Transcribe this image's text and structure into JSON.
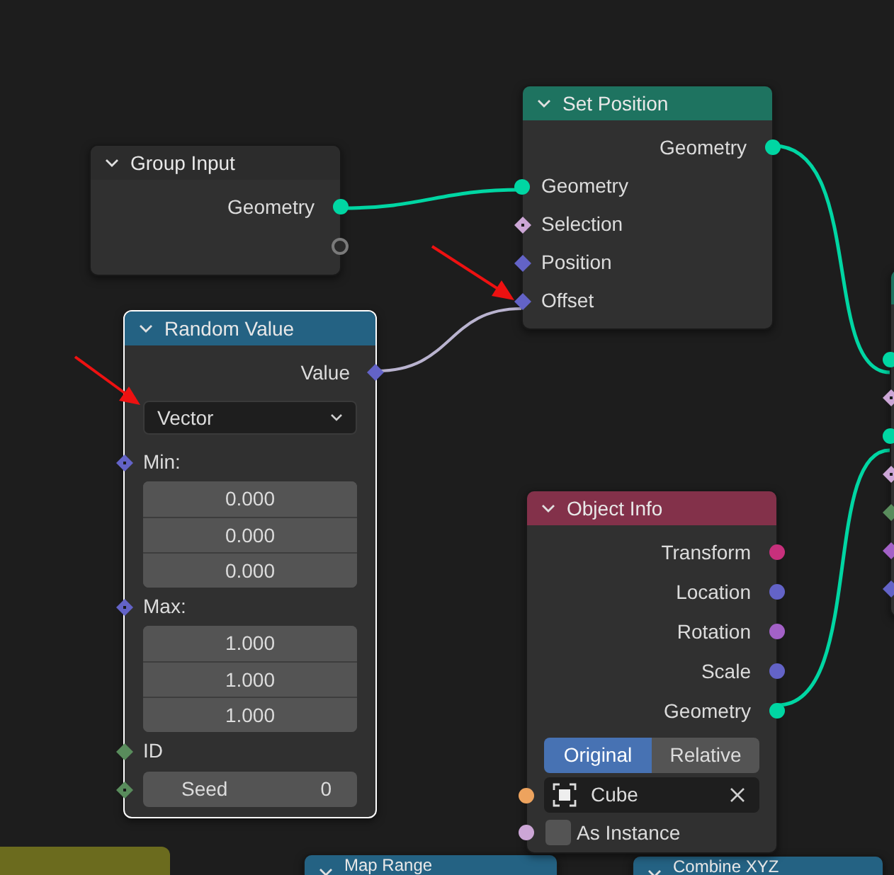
{
  "nodes": [
    {
      "title": "Group Input",
      "color": "#2c2c2c",
      "expanded": true,
      "selected": false,
      "rows": [
        {
          "kind": "output",
          "label": "Geometry",
          "socket": {
            "kind": "circle",
            "color": "#00d6a3"
          }
        },
        {
          "kind": "empty",
          "socket": {
            "kind": "hollow",
            "color": "#7a7a7a"
          }
        }
      ]
    },
    {
      "title": "Set Position",
      "color": "#1e7360",
      "expanded": true,
      "selected": false,
      "rows": [
        {
          "kind": "output",
          "label": "Geometry",
          "socket": {
            "kind": "circle",
            "color": "#00d6a3"
          }
        },
        {
          "kind": "input",
          "label": "Geometry",
          "socket": {
            "kind": "circle",
            "color": "#00d6a3"
          }
        },
        {
          "kind": "input",
          "label": "Selection",
          "socket": {
            "kind": "diamond-dot",
            "color": "#cca6d6"
          }
        },
        {
          "kind": "input",
          "label": "Position",
          "socket": {
            "kind": "diamond",
            "color": "#6363c7"
          }
        },
        {
          "kind": "input",
          "label": "Offset",
          "socket": {
            "kind": "diamond",
            "color": "#6363c7"
          }
        }
      ]
    },
    {
      "title": "Random Value",
      "color": "#246283",
      "expanded": true,
      "selected": true,
      "rows": [
        {
          "kind": "output",
          "label": "Value",
          "socket": {
            "kind": "diamond",
            "color": "#6363c7"
          }
        },
        {
          "kind": "dropdown",
          "value": "Vector"
        },
        {
          "kind": "input",
          "label": "Min:",
          "socket": {
            "kind": "diamond-dot",
            "color": "#6363c7"
          }
        },
        {
          "kind": "vector",
          "values": [
            "0.000",
            "0.000",
            "0.000"
          ]
        },
        {
          "kind": "input",
          "label": "Max:",
          "socket": {
            "kind": "diamond-dot",
            "color": "#6363c7"
          }
        },
        {
          "kind": "vector",
          "values": [
            "1.000",
            "1.000",
            "1.000"
          ]
        },
        {
          "kind": "input",
          "label": "ID",
          "socket": {
            "kind": "diamond",
            "color": "#598c5c"
          }
        },
        {
          "kind": "number",
          "label": "Seed",
          "value": "0",
          "socket": {
            "kind": "diamond-dot",
            "color": "#598c5c"
          }
        }
      ]
    },
    {
      "title": "Object Info",
      "color": "#83314a",
      "expanded": true,
      "selected": false,
      "rows": [
        {
          "kind": "output",
          "label": "Transform",
          "socket": {
            "kind": "circle",
            "color": "#c7307c"
          }
        },
        {
          "kind": "output",
          "label": "Location",
          "socket": {
            "kind": "circle",
            "color": "#6363c7"
          }
        },
        {
          "kind": "output",
          "label": "Rotation",
          "socket": {
            "kind": "circle",
            "color": "#a361c7"
          }
        },
        {
          "kind": "output",
          "label": "Scale",
          "socket": {
            "kind": "circle",
            "color": "#6363c7"
          }
        },
        {
          "kind": "output",
          "label": "Geometry",
          "socket": {
            "kind": "circle",
            "color": "#00d6a3"
          }
        },
        {
          "kind": "segmented",
          "options": [
            {
              "label": "Original",
              "selected": true
            },
            {
              "label": "Relative",
              "selected": false
            }
          ]
        },
        {
          "kind": "object",
          "value": "Cube",
          "socket": {
            "kind": "circle",
            "color": "#eda35e"
          }
        },
        {
          "kind": "checkbox",
          "label": "As Instance",
          "checked": false,
          "socket": {
            "kind": "circle",
            "color": "#cca6d6"
          }
        }
      ]
    },
    {
      "title": "Map Range",
      "color": "#246283",
      "expanded": true,
      "selected": false
    },
    {
      "title": "Combine XYZ",
      "color": "#246283",
      "expanded": true,
      "selected": false
    },
    {
      "color": "#1e7360",
      "selected": false,
      "rows": [
        {
          "kind": "gap"
        },
        {
          "kind": "input",
          "socket": {
            "kind": "circle",
            "color": "#00d6a3"
          }
        },
        {
          "kind": "input",
          "socket": {
            "kind": "diamond-dot",
            "color": "#cca6d6"
          }
        },
        {
          "kind": "input",
          "socket": {
            "kind": "circle",
            "color": "#00d6a3"
          }
        },
        {
          "kind": "input",
          "socket": {
            "kind": "diamond-dot",
            "color": "#cca6d6"
          }
        },
        {
          "kind": "input",
          "socket": {
            "kind": "diamond",
            "color": "#598c5c"
          }
        },
        {
          "kind": "input",
          "socket": {
            "kind": "diamond",
            "color": "#a361c7"
          }
        },
        {
          "kind": "input",
          "socket": {
            "kind": "diamond",
            "color": "#6363c7"
          }
        }
      ]
    }
  ],
  "frame": {
    "color": "#6b6b1e"
  }
}
